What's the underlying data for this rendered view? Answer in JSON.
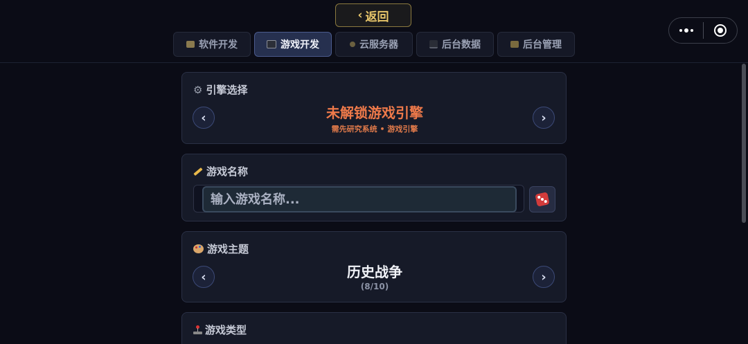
{
  "header": {
    "back_label": "返回",
    "back_chevron": "‹",
    "tabs": [
      {
        "label": "软件开发",
        "icon": "computer-icon",
        "active": false
      },
      {
        "label": "游戏开发",
        "icon": "game-controller-icon",
        "active": true
      },
      {
        "label": "云服务器",
        "icon": "cloud-server-icon",
        "active": false
      },
      {
        "label": "后台数据",
        "icon": "chart-icon",
        "active": false
      },
      {
        "label": "后台管理",
        "icon": "admin-icon",
        "active": false
      }
    ]
  },
  "capsule": {
    "more_icon": "more-dots-icon",
    "close_icon": "close-target-icon"
  },
  "engine": {
    "title": "引擎选择",
    "icon": "gear-icon",
    "value": "未解锁游戏引擎",
    "hint": "需先研究系统 • 游戏引擎",
    "prev": "‹",
    "next": "›"
  },
  "game_name": {
    "title": "游戏名称",
    "icon": "pencil-icon",
    "placeholder": "输入游戏名称...",
    "value": "",
    "random_icon": "dice-icon"
  },
  "theme": {
    "title": "游戏主题",
    "icon": "palette-icon",
    "value": "历史战争",
    "counter": "(8/10)",
    "prev": "‹",
    "next": "›"
  },
  "genre": {
    "title": "游戏类型",
    "icon": "joystick-icon"
  },
  "colors": {
    "accent_gold": "#e8c66a",
    "warning_orange": "#ef7a4a",
    "background": "#0b0c16",
    "card": "#161a28"
  }
}
